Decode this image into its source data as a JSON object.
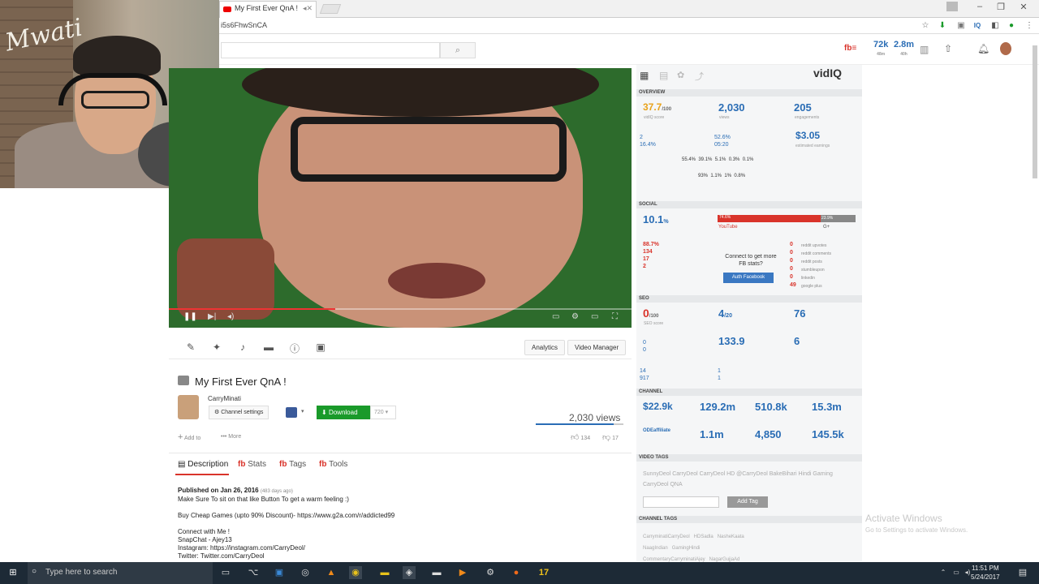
{
  "browser": {
    "tab_title": "My First Ever QnA !",
    "url": "i5s6FhwSnCA"
  },
  "header": {
    "stat1": "72k",
    "stat1_sub": "48m",
    "stat2": "2.8m",
    "stat2_sub": "40h"
  },
  "cam": {
    "sign": "Mwati"
  },
  "video": {
    "title": "My First Ever QnA !",
    "channel": "CarryMinati",
    "views": "2,030 views",
    "likes": "134",
    "dislikes": "17"
  },
  "toolbar": {
    "analytics": "Analytics",
    "video_manager": "Video Manager",
    "channel_settings": "Channel settings",
    "download": "Download",
    "quality": "720",
    "add_to": "Add to",
    "more": "More"
  },
  "tabs": {
    "description": "Description",
    "stats": "Stats",
    "tags": "Tags",
    "tools": "Tools"
  },
  "desc": {
    "published": "Published on Jan 26, 2016",
    "ago": "(483 days ago)",
    "body": "Make Sure To sit on that like Button To get a warm feeling :)\n\nBuy Cheap Games (upto 90% Discount)- https://www.g2a.com/r/addicted99\n\nConnect with Me !\nSnapChat - Ajey13\nInstagram: https://instagram.com/CarryDeol/\nTwitter: Twitter.com/CarryDeol\nFacebook Page: https://www.facebook.com/CarryDeol"
  },
  "vidiq": {
    "logo": "vidIQ",
    "overview": "OVERVIEW",
    "score": "37.7",
    "score_of": "/100",
    "score_lbl": "vidIQ score",
    "views": "2,030",
    "views_lbl": "views",
    "eng": "205",
    "eng_lbl": "engagements",
    "subs_driven": "2",
    "subs_pct": "16.4%",
    "avg_view": "52.6%",
    "duration": "05:20",
    "earn": "3.05",
    "earn_lbl": "estimated earnings",
    "devices": "55.4%  39.1%  5.1%  0.3%  0.1%",
    "countries": "93%  1.1%  1%  0.8%",
    "social": "SOCIAL",
    "eng_rate": "10.1",
    "yt_pct": "74.6%",
    "gplus_pct": "23.9%",
    "youtube": "YouTube",
    "gplus": "G+",
    "like_ratio": "88.7%",
    "yt_likes": "134",
    "yt_dislikes": "17",
    "yt_shares": "2",
    "fb_connect": "Connect to get more FB stats?",
    "auth_fb": "Auth Facebook",
    "reddit_vals": "0\n0\n0\n0\n0\n49",
    "reddit_lbls": "reddit upvotes\nreddit comments\nreddit posts\nstumbleupon\nlinkedin\ngoogle plus",
    "seo": "SEO",
    "seo_score": "0",
    "seo_of": "/100",
    "seo_lbl": "SEO score",
    "tags_used": "4",
    "tags_of": "/20",
    "word_count": "76",
    "words_pm": "133.9",
    "links": "6",
    "annotations": "0",
    "cards": "0",
    "search_views": "14",
    "suggested": "917",
    "referred": "1",
    "embed": "1",
    "channel": "CHANNEL",
    "rev": "22.9k",
    "total_views": "129.2m",
    "daily_views": "510.8k",
    "views_30": "15.3m",
    "ch_aff": "ODEaffiliate",
    "subs": "1.1m",
    "daily_subs": "4,850",
    "subs_30": "145.5k",
    "video_tags": "VIDEO TAGS",
    "tags_text": "SunnyDeol CarryDeol CarryDeol HD @CarryDeol BakeBihari Hindi Gaming CarryDeol QNA",
    "add_tag": "Add Tag",
    "channel_tags": "CHANNEL TAGS",
    "ch_tags": "CarryminatiCarryDeol   HDSadla   NasheKaata\nNaagIndian   GamingHindi\nCommentaryCarryminatiAjey   NagarGujjaAd"
  },
  "watermark": {
    "line1": "Activate Windows",
    "line2": "Go to Settings to activate Windows."
  },
  "taskbar": {
    "search": "Type here to search",
    "time": "11:51 PM",
    "date": "5/24/2017"
  }
}
